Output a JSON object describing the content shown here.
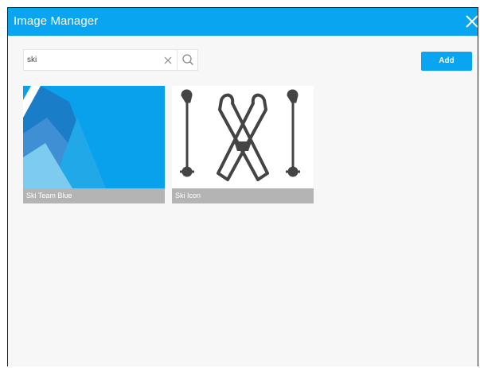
{
  "dialog": {
    "title": "Image Manager",
    "close_icon": "close-icon"
  },
  "search": {
    "value": "ski",
    "placeholder": "",
    "clear_icon": "clear-x-icon",
    "search_icon": "magnifier-icon"
  },
  "toolbar": {
    "add_label": "Add"
  },
  "images": [
    {
      "label": "Ski Team Blue",
      "thumbnail": "blue-mountains"
    },
    {
      "label": "Ski Icon",
      "thumbnail": "skis-and-poles"
    }
  ],
  "colors": {
    "accent": "#0aa5f0",
    "label_bar": "#b4b4b4",
    "background": "#f7f7f7"
  }
}
